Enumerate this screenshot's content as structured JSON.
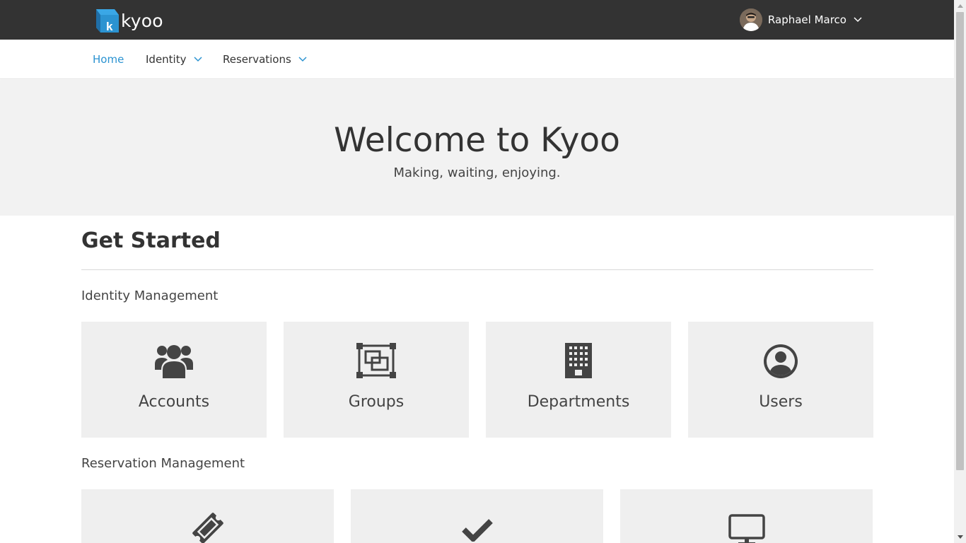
{
  "app": {
    "logo_text": "kyoo",
    "logo_letter": "k",
    "brand_color": "#2b93d1"
  },
  "user": {
    "name": "Raphael Marco"
  },
  "nav": {
    "items": [
      {
        "label": "Home",
        "active": true,
        "has_dropdown": false
      },
      {
        "label": "Identity",
        "active": false,
        "has_dropdown": true
      },
      {
        "label": "Reservations",
        "active": false,
        "has_dropdown": true
      }
    ]
  },
  "hero": {
    "title": "Welcome to Kyoo",
    "subtitle": "Making, waiting, enjoying."
  },
  "get_started": {
    "title": "Get Started",
    "identity_heading": "Identity Management",
    "identity_tiles": [
      {
        "label": "Accounts",
        "icon": "users-icon"
      },
      {
        "label": "Groups",
        "icon": "object-group-icon"
      },
      {
        "label": "Departments",
        "icon": "building-icon"
      },
      {
        "label": "Users",
        "icon": "user-circle-icon"
      }
    ],
    "reservation_heading": "Reservation Management",
    "reservation_tiles": [
      {
        "label": "",
        "icon": "ticket-icon"
      },
      {
        "label": "",
        "icon": "check-icon"
      },
      {
        "label": "",
        "icon": "desktop-icon"
      }
    ]
  },
  "colors": {
    "topbar": "#333333",
    "hero_bg": "#f2f2f2",
    "tile_bg": "#efefef",
    "active_link": "#2b93d1",
    "icon": "#444444"
  }
}
